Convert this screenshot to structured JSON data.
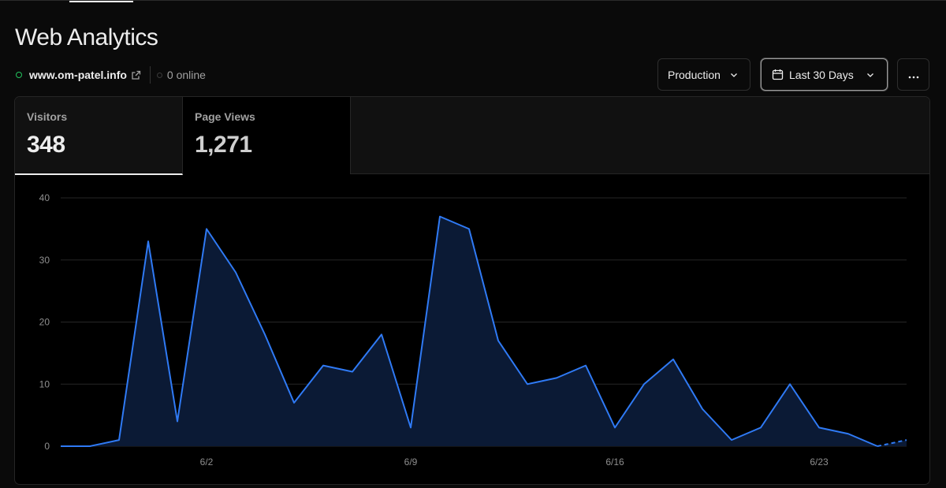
{
  "header": {
    "title": "Web Analytics",
    "site": "www.om-patel.info",
    "online_status": "0 online"
  },
  "controls": {
    "environment": "Production",
    "range": "Last 30 Days",
    "more_label": "···"
  },
  "tabs": [
    {
      "label": "Visitors",
      "value": "348"
    },
    {
      "label": "Page Views",
      "value": "1,271"
    }
  ],
  "colors": {
    "accent_line": "#2f7af5",
    "area_fill": "#0b1a35",
    "status_green": "#22c55e"
  },
  "chart_data": {
    "type": "area",
    "series": [
      {
        "values": [
          0,
          0,
          1,
          33,
          4,
          35,
          28,
          18,
          7,
          13,
          12,
          18,
          3,
          37,
          35,
          17,
          10,
          11,
          13,
          3,
          10,
          14,
          6,
          1,
          3,
          10,
          3,
          2,
          0,
          1
        ]
      }
    ],
    "projected_from_index": 28,
    "ylim": [
      0,
      40
    ],
    "yticks": [
      0,
      10,
      20,
      30,
      40
    ],
    "xticks": [
      {
        "index": 5,
        "label": "6/2"
      },
      {
        "index": 12,
        "label": "6/9"
      },
      {
        "index": 19,
        "label": "6/16"
      },
      {
        "index": 26,
        "label": "6/23"
      }
    ],
    "grid": true
  }
}
